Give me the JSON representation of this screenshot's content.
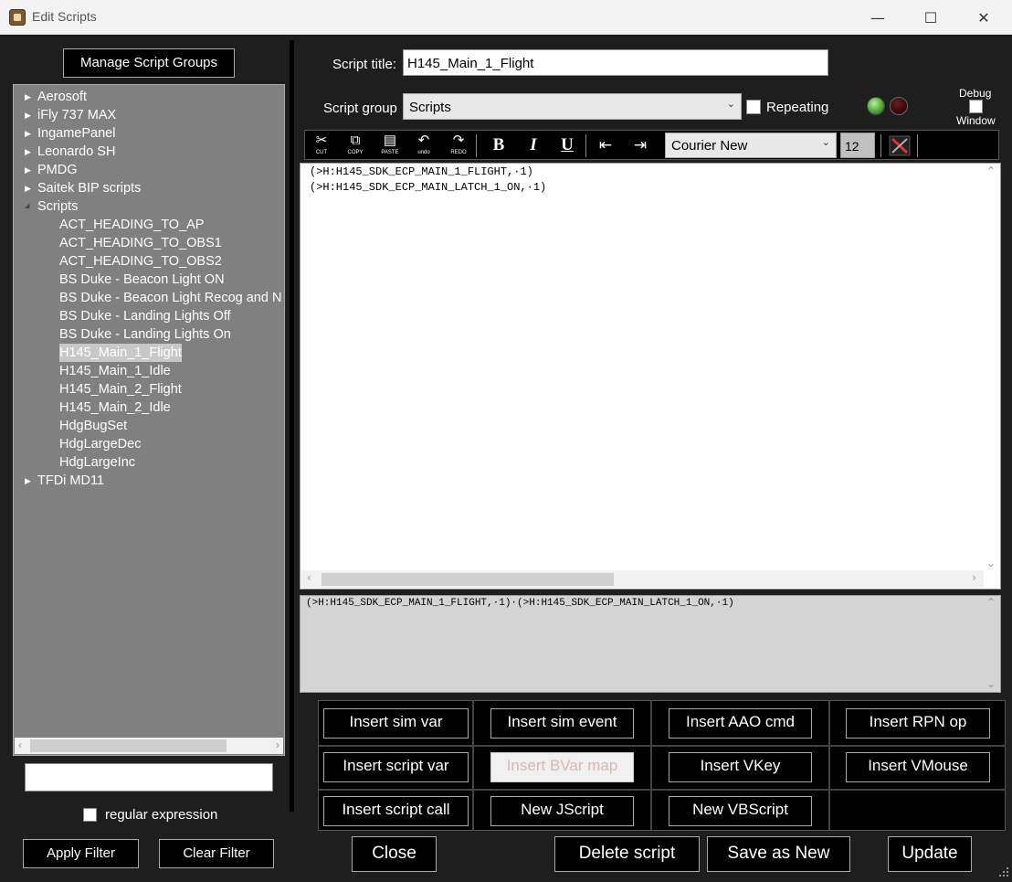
{
  "window": {
    "title": "Edit Scripts",
    "minimize": "—",
    "maximize": "☐",
    "close": "✕"
  },
  "left": {
    "manage_groups": "Manage Script Groups",
    "tree": [
      {
        "label": "Aerosoft",
        "type": "group",
        "expanded": false
      },
      {
        "label": "iFly 737 MAX",
        "type": "group",
        "expanded": false
      },
      {
        "label": "IngamePanel",
        "type": "group",
        "expanded": false
      },
      {
        "label": "Leonardo SH",
        "type": "group",
        "expanded": false
      },
      {
        "label": "PMDG",
        "type": "group",
        "expanded": false
      },
      {
        "label": "Saitek BIP scripts",
        "type": "group",
        "expanded": false
      },
      {
        "label": "Scripts",
        "type": "group",
        "expanded": true
      },
      {
        "label": "ACT_HEADING_TO_AP",
        "type": "item"
      },
      {
        "label": "ACT_HEADING_TO_OBS1",
        "type": "item"
      },
      {
        "label": "ACT_HEADING_TO_OBS2",
        "type": "item"
      },
      {
        "label": "BS Duke - Beacon Light ON",
        "type": "item"
      },
      {
        "label": "BS Duke - Beacon Light Recog and N",
        "type": "item"
      },
      {
        "label": "BS Duke - Landing Lights Off",
        "type": "item"
      },
      {
        "label": "BS Duke - Landing Lights On",
        "type": "item"
      },
      {
        "label": "H145_Main_1_Flight",
        "type": "item",
        "selected": true
      },
      {
        "label": "H145_Main_1_Idle",
        "type": "item"
      },
      {
        "label": "H145_Main_2_Flight",
        "type": "item"
      },
      {
        "label": "H145_Main_2_Idle",
        "type": "item"
      },
      {
        "label": "HdgBugSet",
        "type": "item"
      },
      {
        "label": "HdgLargeDec",
        "type": "item"
      },
      {
        "label": "HdgLargeInc",
        "type": "item"
      },
      {
        "label": "TFDi MD11",
        "type": "group",
        "expanded": false
      }
    ],
    "filter_value": "",
    "regex_label": "regular expression",
    "regex_checked": false,
    "apply_filter": "Apply Filter",
    "clear_filter": "Clear Filter"
  },
  "editor": {
    "title_label": "Script title:",
    "title_value": "H145_Main_1_Flight",
    "group_label": "Script group",
    "group_value": "Scripts",
    "repeating_label": "Repeating",
    "repeating_checked": false,
    "debug_label": "Debug",
    "window_label": "Window",
    "led_active_color": "#48a030",
    "led_inactive_color": "#3a0808",
    "toolbar": {
      "cut": {
        "glyph": "✂",
        "caption": "CUT"
      },
      "copy": {
        "glyph": "⧉",
        "caption": "COPY"
      },
      "paste": {
        "glyph": "▤",
        "caption": "PASTE"
      },
      "undo": {
        "glyph": "↶",
        "caption": "undo"
      },
      "redo": {
        "glyph": "↷",
        "caption": "REDO"
      },
      "bold": "B",
      "italic": "I",
      "underline": "U",
      "outdent": "⇤",
      "indent": "⇥",
      "font": "Courier New",
      "font_size": "12"
    },
    "code_lines": [
      "(>H:H145_SDK_ECP_MAIN_1_FLIGHT,·1)",
      "(>H:H145_SDK_ECP_MAIN_LATCH_1_ON,·1)"
    ],
    "preview": "(>H:H145_SDK_ECP_MAIN_1_FLIGHT,·1)·(>H:H145_SDK_ECP_MAIN_LATCH_1_ON,·1)"
  },
  "insert": {
    "sim_var": "Insert sim var",
    "sim_event": "Insert sim event",
    "aao_cmd": "Insert AAO cmd",
    "rpn_op": "Insert RPN op",
    "script_var": "Insert script var",
    "bvar_map": "Insert BVar map",
    "vkey": "Insert VKey",
    "vmouse": "Insert VMouse",
    "script_call": "Insert script call",
    "new_jscript": "New JScript",
    "new_vbscript": "New VBScript"
  },
  "actions": {
    "close": "Close",
    "delete": "Delete script",
    "save_new": "Save as New",
    "update": "Update"
  }
}
